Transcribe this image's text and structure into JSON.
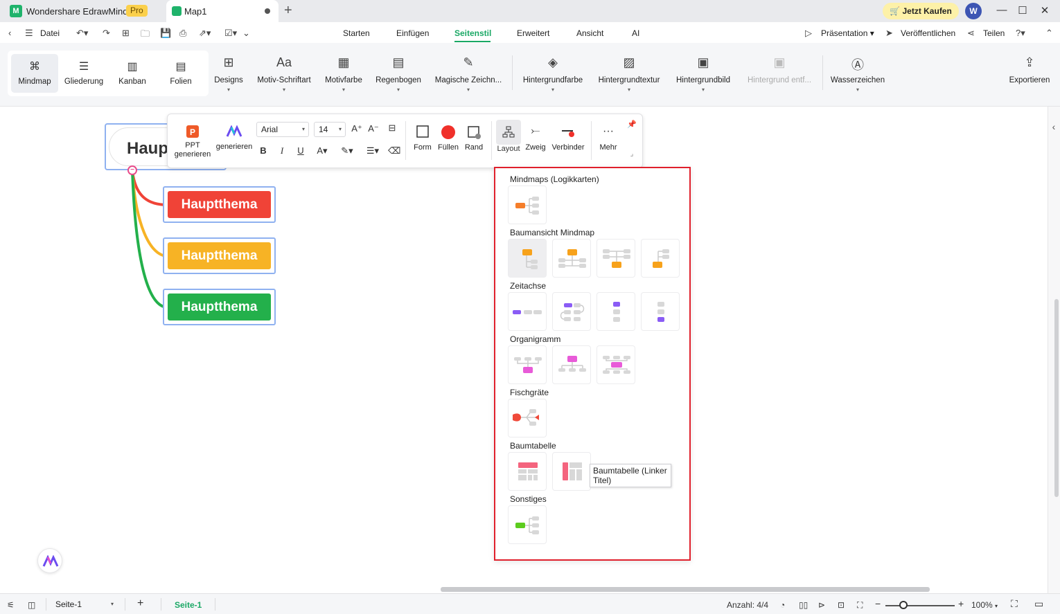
{
  "titlebar": {
    "app_name": "Wondershare EdrawMind",
    "badge": "Pro",
    "doc_tab": "Map1",
    "buy": "Jetzt Kaufen",
    "avatar": "W"
  },
  "menubar": {
    "file": "Datei",
    "tabs": [
      "Starten",
      "Einfügen",
      "Seitenstil",
      "Erweitert",
      "Ansicht",
      "AI"
    ],
    "active_tab": "Seitenstil",
    "presentation": "Präsentation",
    "publish": "Veröffentlichen",
    "share": "Teilen"
  },
  "ribbon": {
    "views": [
      "Mindmap",
      "Gliederung",
      "Kanban",
      "Folien"
    ],
    "selected_view": "Mindmap",
    "buttons": {
      "designs": "Designs",
      "font": "Motiv-Schriftart",
      "color": "Motivfarbe",
      "rainbow": "Regenbogen",
      "magic": "Magische Zeichn...",
      "bgcolor": "Hintergrundfarbe",
      "bgtexture": "Hintergrundtextur",
      "bgimage": "Hintergrundbild",
      "bgremove": "Hintergrund entf...",
      "watermark": "Wasserzeichen",
      "export": "Exportieren"
    }
  },
  "canvas": {
    "central_topic": "Haup",
    "topics": [
      {
        "label": "Hauptthema",
        "color": "#f04337"
      },
      {
        "label": "Hauptthema",
        "color": "#f7b325"
      },
      {
        "label": "Hauptthema",
        "color": "#23b04b"
      }
    ]
  },
  "float_toolbar": {
    "ppt_label_1": "PPT",
    "ppt_label_2": "generieren",
    "ai_label": "generieren",
    "font": "Arial",
    "size": "14",
    "shape": "Form",
    "fill": "Füllen",
    "border": "Rand",
    "layout": "Layout",
    "branch": "Zweig",
    "connector": "Verbinder",
    "more": "Mehr"
  },
  "layout_panel": {
    "sections": {
      "mindmaps": "Mindmaps (Logikkarten)",
      "tree": "Baumansicht Mindmap",
      "timeline": "Zeitachse",
      "org": "Organigramm",
      "fishbone": "Fischgräte",
      "treetable": "Baumtabelle",
      "other": "Sonstiges"
    },
    "tooltip": "Baumtabelle (Linker Titel)"
  },
  "statusbar": {
    "page_select": "Seite-1",
    "page_tab": "Seite-1",
    "count": "Anzahl: 4/4",
    "zoom": "100%"
  },
  "colors": {
    "accent": "#1aa865",
    "highlight_border": "#e0202c",
    "selection": "#8fb1f0"
  }
}
